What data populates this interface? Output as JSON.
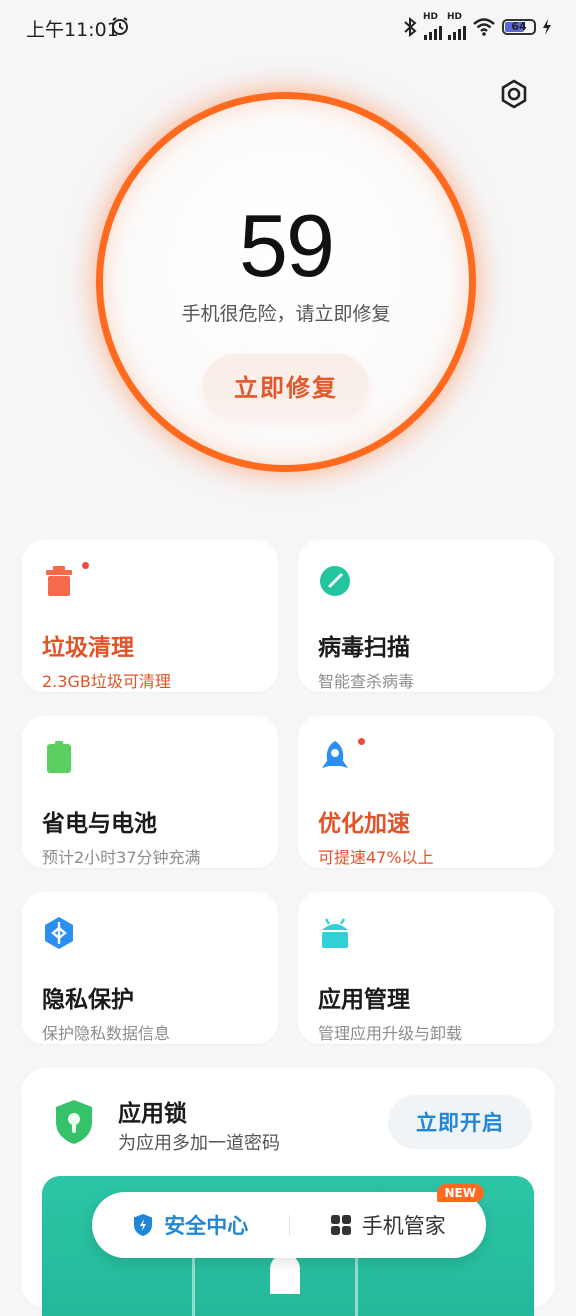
{
  "status_bar": {
    "time": "上午11:01",
    "signal1_label": "HD",
    "signal2_label": "HD",
    "battery_level": "64"
  },
  "header": {
    "settings_icon": "gear-icon"
  },
  "score": {
    "value": "59",
    "message": "手机很危险，请立即修复",
    "fix_button": "立即修复",
    "ring_color": "#ff6a1f"
  },
  "cards": [
    {
      "title": "垃圾清理",
      "subtitle": "2.3GB垃圾可清理",
      "icon": "trash-icon",
      "icon_color": "#f56a4a",
      "alert": true,
      "badge_dot": true
    },
    {
      "title": "病毒扫描",
      "subtitle": "智能查杀病毒",
      "icon": "radar-icon",
      "icon_color": "#23c59e",
      "alert": false,
      "badge_dot": false
    },
    {
      "title": "省电与电池",
      "subtitle": "预计2小时37分钟充满",
      "icon": "battery-icon",
      "icon_color": "#5bcf62",
      "alert": false,
      "badge_dot": false
    },
    {
      "title": "优化加速",
      "subtitle": "可提速47%以上",
      "icon": "rocket-icon",
      "icon_color": "#2b8ff0",
      "alert": true,
      "badge_dot": true
    },
    {
      "title": "隐私保护",
      "subtitle": "保护隐私数据信息",
      "icon": "privacy-shield-icon",
      "icon_color": "#2b8ff0",
      "alert": false,
      "badge_dot": false
    },
    {
      "title": "应用管理",
      "subtitle": "管理应用升级与卸载",
      "icon": "android-icon",
      "icon_color": "#30d0d6",
      "alert": false,
      "badge_dot": false
    }
  ],
  "app_lock": {
    "title": "应用锁",
    "subtitle": "为应用多加一道密码",
    "button": "立即开启",
    "icon": "lock-shield-icon"
  },
  "bottom_tabs": {
    "security": "安全中心",
    "manager": "手机管家",
    "new_badge": "NEW"
  }
}
